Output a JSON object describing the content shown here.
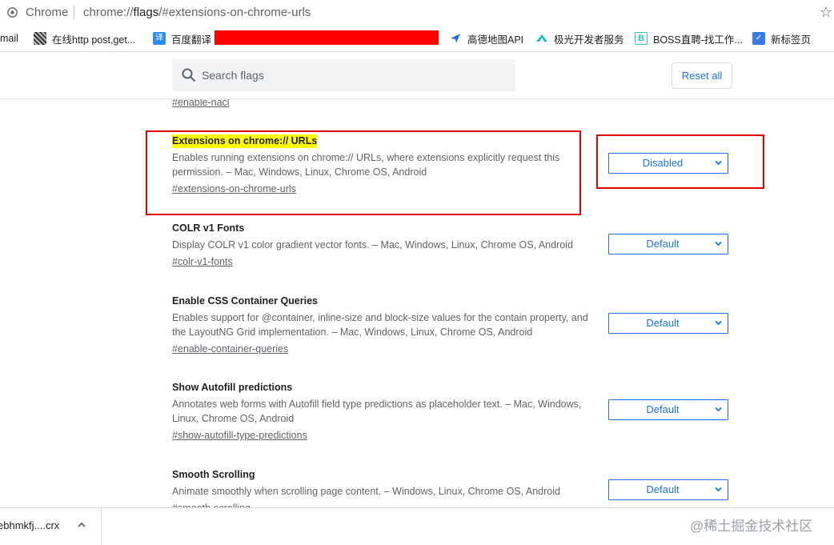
{
  "address_bar": {
    "site_label": "Chrome",
    "url_prefix": "chrome://",
    "url_host": "flags",
    "url_rest": "/#extensions-on-chrome-urls"
  },
  "bookmarks": [
    {
      "label": "mail",
      "icon": "none"
    },
    {
      "label": "在线http post,get...",
      "icon": "qr-icon"
    },
    {
      "label": "百度翻译",
      "icon": "translate-icon"
    },
    {
      "label": "高德地图API",
      "icon": "amap-icon"
    },
    {
      "label": "极光开发者服务",
      "icon": "jiguang-icon"
    },
    {
      "label": "BOSS直聘-找工作...",
      "icon": "boss-icon"
    },
    {
      "label": "新标签页",
      "icon": "newtab-icon"
    }
  ],
  "toolbar": {
    "search_placeholder": "Search flags",
    "reset_label": "Reset all"
  },
  "previous_flag_link": "#enable-nacl",
  "flags": [
    {
      "title": "Extensions on chrome:// URLs",
      "description": "Enables running extensions on chrome:// URLs, where extensions explicitly request this permission. – Mac, Windows, Linux, Chrome OS, Android",
      "link": "#extensions-on-chrome-urls",
      "value": "Disabled",
      "highlighted": true
    },
    {
      "title": "COLR v1 Fonts",
      "description": "Display COLR v1 color gradient vector fonts. – Mac, Windows, Linux, Chrome OS, Android",
      "link": "#colr-v1-fonts",
      "value": "Default"
    },
    {
      "title": "Enable CSS Container Queries",
      "description": "Enables support for @container, inline-size and block-size values for the contain property, and the LayoutNG Grid implementation. – Mac, Windows, Linux, Chrome OS, Android",
      "link": "#enable-container-queries",
      "value": "Default"
    },
    {
      "title": "Show Autofill predictions",
      "description": "Annotates web forms with Autofill field type predictions as placeholder text. – Mac, Windows, Linux, Chrome OS, Android",
      "link": "#show-autofill-type-predictions",
      "value": "Default"
    },
    {
      "title": "Smooth Scrolling",
      "description": "Animate smoothly when scrolling page content. – Windows, Linux, Chrome OS, Android",
      "link": "#smooth-scrolling",
      "value": "Default"
    }
  ],
  "download_shelf": {
    "filename": "ebhmkfj....crx"
  },
  "watermark": "@稀土掘金技术社区",
  "colors": {
    "accent": "#1a73e8",
    "highlight": "#ffff00",
    "annotation_red": "#e00000"
  }
}
